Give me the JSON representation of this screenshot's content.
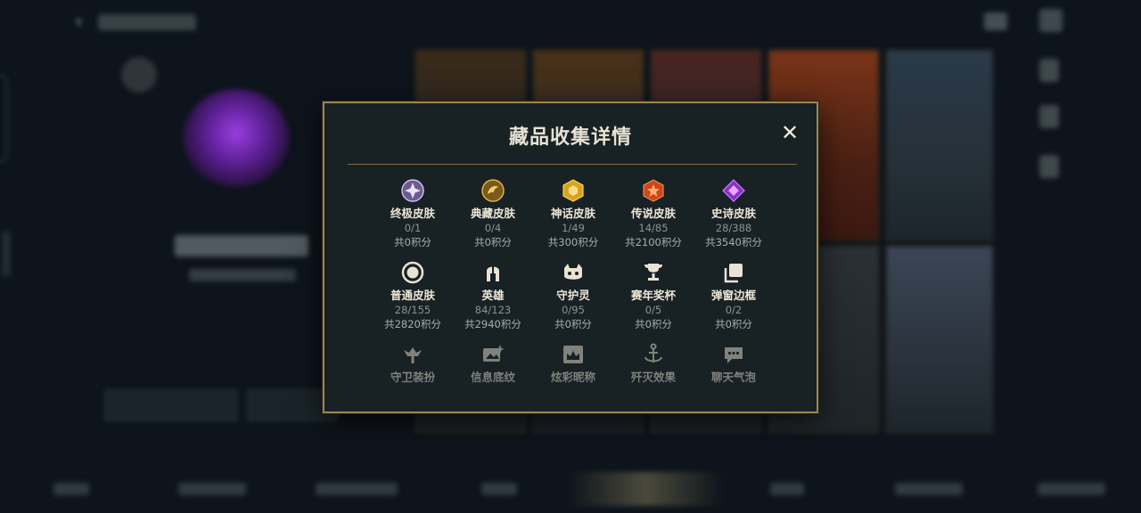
{
  "colors": {
    "modal_bg": "#182124",
    "gold_border": "#9b8550",
    "title_text": "#e8e3d5",
    "count_text": "#8a9398",
    "points_text": "#a8aeb0"
  },
  "modal": {
    "title": "藏品收集详情",
    "close_icon": "close-icon"
  },
  "categories": [
    {
      "name": "终极皮肤",
      "count": "0/1",
      "points": "共0积分",
      "icon": "ultimate-skin-icon"
    },
    {
      "name": "典藏皮肤",
      "count": "0/4",
      "points": "共0积分",
      "icon": "prestige-skin-icon"
    },
    {
      "name": "神话皮肤",
      "count": "1/49",
      "points": "共300积分",
      "icon": "mythic-skin-icon"
    },
    {
      "name": "传说皮肤",
      "count": "14/85",
      "points": "共2100积分",
      "icon": "legendary-skin-icon"
    },
    {
      "name": "史诗皮肤",
      "count": "28/388",
      "points": "共3540积分",
      "icon": "epic-skin-icon"
    },
    {
      "name": "普通皮肤",
      "count": "28/155",
      "points": "共2820积分",
      "icon": "normal-skin-icon"
    },
    {
      "name": "英雄",
      "count": "84/123",
      "points": "共2940积分",
      "icon": "champion-helmet-icon"
    },
    {
      "name": "守护灵",
      "count": "0/95",
      "points": "共0积分",
      "icon": "guardian-pet-icon"
    },
    {
      "name": "赛年奖杯",
      "count": "0/5",
      "points": "共0积分",
      "icon": "trophy-icon"
    },
    {
      "name": "弹窗边框",
      "count": "0/2",
      "points": "共0积分",
      "icon": "popup-frame-icon"
    },
    {
      "name": "守卫装扮",
      "icon": "ward-skin-icon"
    },
    {
      "name": "信息底纹",
      "icon": "info-pattern-icon"
    },
    {
      "name": "炫彩昵称",
      "icon": "colorful-nickname-icon"
    },
    {
      "name": "歼灭效果",
      "icon": "ace-effect-icon"
    },
    {
      "name": "聊天气泡",
      "icon": "chat-bubble-icon"
    }
  ]
}
